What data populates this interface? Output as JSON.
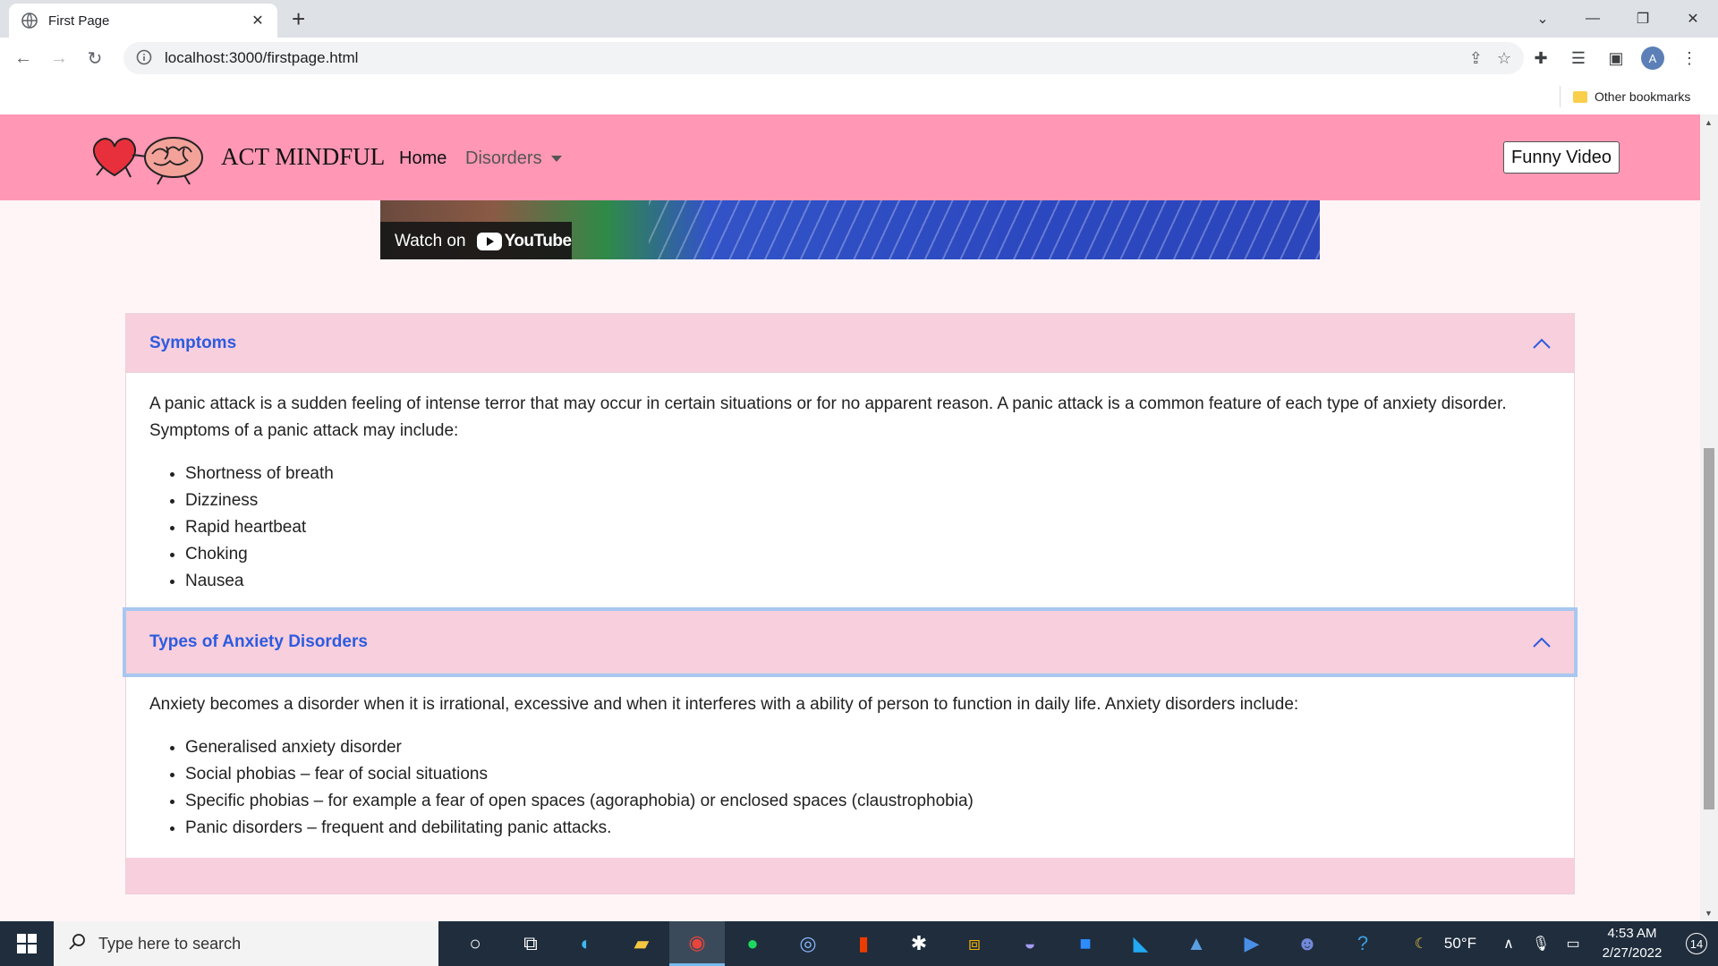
{
  "browser": {
    "tab_title": "First Page",
    "url": "localhost:3000/firstpage.html",
    "bookmark_other": "Other bookmarks"
  },
  "navbar": {
    "brand": "ACT MINDFUL",
    "home": "Home",
    "disorders": "Disorders",
    "funny_video": "Funny Video",
    "bg_color": "#ff97b5"
  },
  "video": {
    "watch_on": "Watch on",
    "youtube": "YouTube"
  },
  "accordion": [
    {
      "title": "Symptoms",
      "text": "A panic attack is a sudden feeling of intense terror that may occur in certain situations or for no apparent reason. A panic attack is a common feature of each type of anxiety disorder. Symptoms of a panic attack may include:",
      "items": [
        "Shortness of breath",
        "Dizziness",
        "Rapid heartbeat",
        "Choking",
        "Nausea"
      ]
    },
    {
      "title": "Types of Anxiety Disorders",
      "text": "Anxiety becomes a disorder when it is irrational, excessive and when it interferes with a ability of person to function in daily life. Anxiety disorders include:",
      "items": [
        "Generalised anxiety disorder",
        "Social phobias – fear of social situations",
        "Specific phobias – for example a fear of open spaces (agoraphobia) or enclosed spaces (claustrophobia)",
        "Panic disorders – frequent and debilitating panic attacks."
      ]
    }
  ],
  "taskbar": {
    "search_placeholder": "Type here to search",
    "temperature": "50°F",
    "time": "4:53 AM",
    "date": "2/27/2022",
    "notification_count": "14"
  }
}
